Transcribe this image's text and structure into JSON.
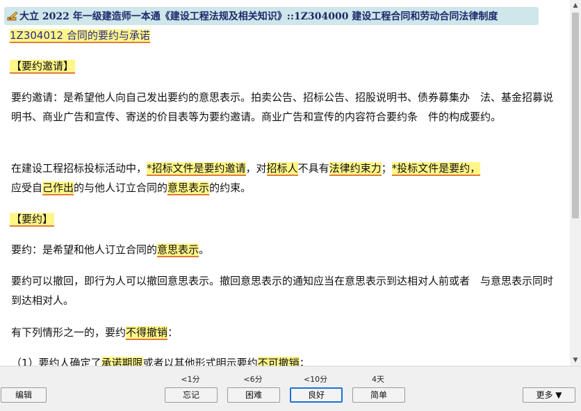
{
  "title": {
    "text": "大立 2022 年一级建造师一本通《建设工程法规及相关知识》::1Z304000 建设工程合同和劳动合同法律制度",
    "icon": "pencil-icon"
  },
  "section": {
    "code": "1Z304012 合同的要约与承诺"
  },
  "heading1": "【要约邀请】",
  "para1": "要约邀请：是希望他人向自己发出要约的意思表示。拍卖公告、招标公告、招股说明书、债券募集办　法、基金招募说明书、商业广告和宣传、寄送的价目表等为要约邀请。商业广告和宣传的内容符合要约条　件的构成要约。",
  "para2": {
    "t1": "在建设工程招标投标活动中，",
    "h1": "*招标文件是要约邀请",
    "t2": "，对",
    "h2": "招标人",
    "t3": "不具有",
    "h3": "法律约束力",
    "t4": "；",
    "h4": "*投标文件是要约，",
    "h5": " ",
    "t5": "应受自",
    "h6": "己作出",
    "t6": "的与他人订立合同的",
    "h7": "意思表示",
    "t7": "的约束。"
  },
  "heading2": "【要约】",
  "para3": {
    "t1": "要约：是希望和他人订立合同的",
    "h1": "意思表示",
    "t2": "。"
  },
  "para4": "要约可以撤回，即行为人可以撤回意思表示。撤回意思表示的通知应当在意思表示到达相对人前或者　与意思表示同时到达相对人。",
  "para5": {
    "t1": "有下列情形之一的，要约",
    "h1": "不得撤销",
    "t2": "："
  },
  "para6": {
    "t1": "（1）要约人确定了",
    "h1": "承诺期限",
    "t2": "或者以其他形式明示要约",
    "h2": "不可撤销",
    "t3": "；"
  },
  "footer": {
    "edit_label": "编辑",
    "more_label": "更多 ▼",
    "answers": [
      {
        "time": "<1分",
        "label": "忘记"
      },
      {
        "time": "<6分",
        "label": "困难"
      },
      {
        "time": "<10分",
        "label": "良好"
      },
      {
        "time": "4天",
        "label": "简单"
      }
    ]
  }
}
